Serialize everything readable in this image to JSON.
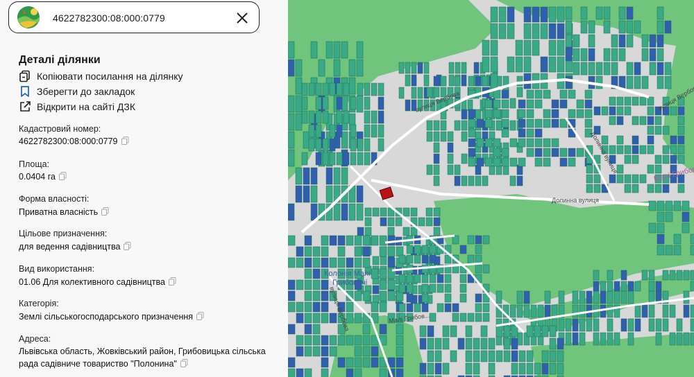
{
  "search": {
    "value": "4622782300:08:000:0779"
  },
  "details": {
    "title": "Деталі ділянки",
    "actions": {
      "copy_link": "Копіювати посилання на ділянку",
      "bookmark": "Зберегти до закладок",
      "open_dzk": "Відкрити на сайті ДЗК"
    },
    "fields": {
      "cadastral_label": "Кадастровий номер:",
      "cadastral_value": "4622782300:08:000:0779",
      "area_label": "Площа:",
      "area_value": "0.0404 га",
      "ownership_label": "Форма власності:",
      "ownership_value": "Приватна власність",
      "purpose_label": "Цільове призначення:",
      "purpose_value": "для ведення садівництва",
      "usage_label": "Вид використання:",
      "usage_value": "01.06 Для колективного садівництва",
      "category_label": "Категорія:",
      "category_value": "Землі сільськогосподарського призначення",
      "address_label": "Адреса:",
      "address_line1": "Львівська область, Жовківський район, Грибовицька сільська",
      "address_line2": "рада садівниче товариство \"Полонина\""
    }
  },
  "map": {
    "labels": {
      "verbova_a": "вулиця Вербова",
      "verbova_b": "вулиця Вербова",
      "dolynna_a": "Долинна вулиця",
      "dolynna_b": "Долинна вулиця",
      "mali_hrybovychi": "Малі Грибовичі",
      "koloniia_line1": "Колонія Малі",
      "koloniia_line2": "Грибовичі",
      "hrybov_street": "Малі Грибов...",
      "vertical_street": "вулиця Вербова"
    },
    "colors": {
      "forest": "#70c47c",
      "builtup": "#d8d8d8",
      "parcel_teal": "#3aaa86",
      "parcel_blue": "#2f5fae",
      "selected": "#b81414",
      "road": "#ffffff"
    }
  }
}
